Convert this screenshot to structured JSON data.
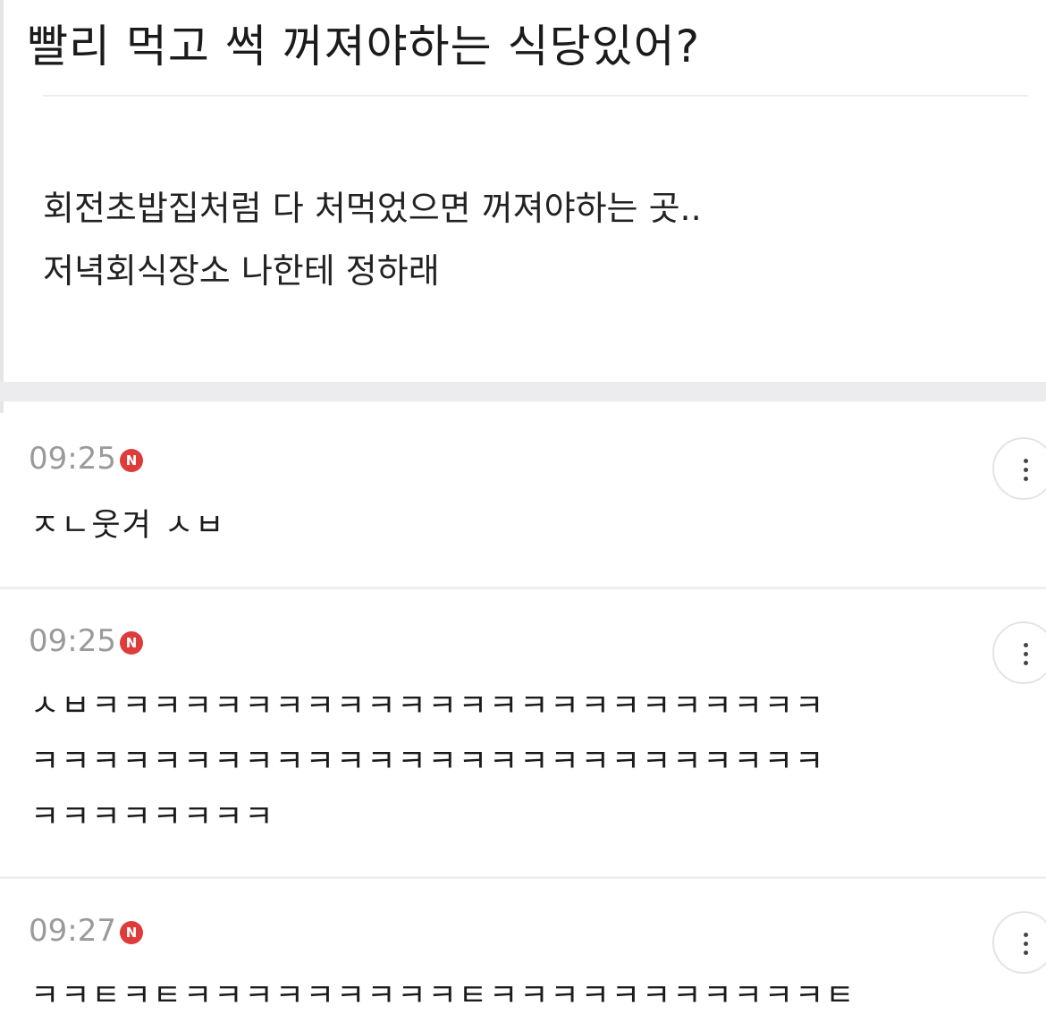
{
  "post": {
    "title": "빨리 먹고 썩 꺼져야하는 식당있어?",
    "body_lines": [
      "회전초밥집처럼 다 처먹었으면 꺼져야하는 곳..",
      "저녁회식장소 나한테 정하래"
    ]
  },
  "comments": [
    {
      "time": "09:25",
      "badge": "N",
      "text": "ㅈㄴ웃겨 ㅅㅂ"
    },
    {
      "time": "09:25",
      "badge": "N",
      "text": "ㅅㅂㅋㅋㅋㅋㅋㅋㅋㅋㅋㅋㅋㅋㅋㅋㅋㅋㅋㅋㅋㅋㅋㅋㅋㅋ\nㅋㅋㅋㅋㅋㅋㅋㅋㅋㅋㅋㅋㅋㅋㅋㅋㅋㅋㅋㅋㅋㅋㅋㅋㅋㅋ\nㅋㅋㅋㅋㅋㅋㅋㅋ"
    },
    {
      "time": "09:27",
      "badge": "N",
      "text": "ㅋㅋㅌㅋㅌㅋㅋㅋㅋㅋㅋㅋㅋㅋㅌㅋㅋㅋㅋㅋㅋㅋㅋㅋㅋㅋㅌ"
    }
  ],
  "colors": {
    "badge": "#de3b3b",
    "timestamp": "#9a9a9a",
    "divider": "#ececee"
  },
  "icons": {
    "badge": "new-badge-icon",
    "more": "more-vertical-icon"
  }
}
